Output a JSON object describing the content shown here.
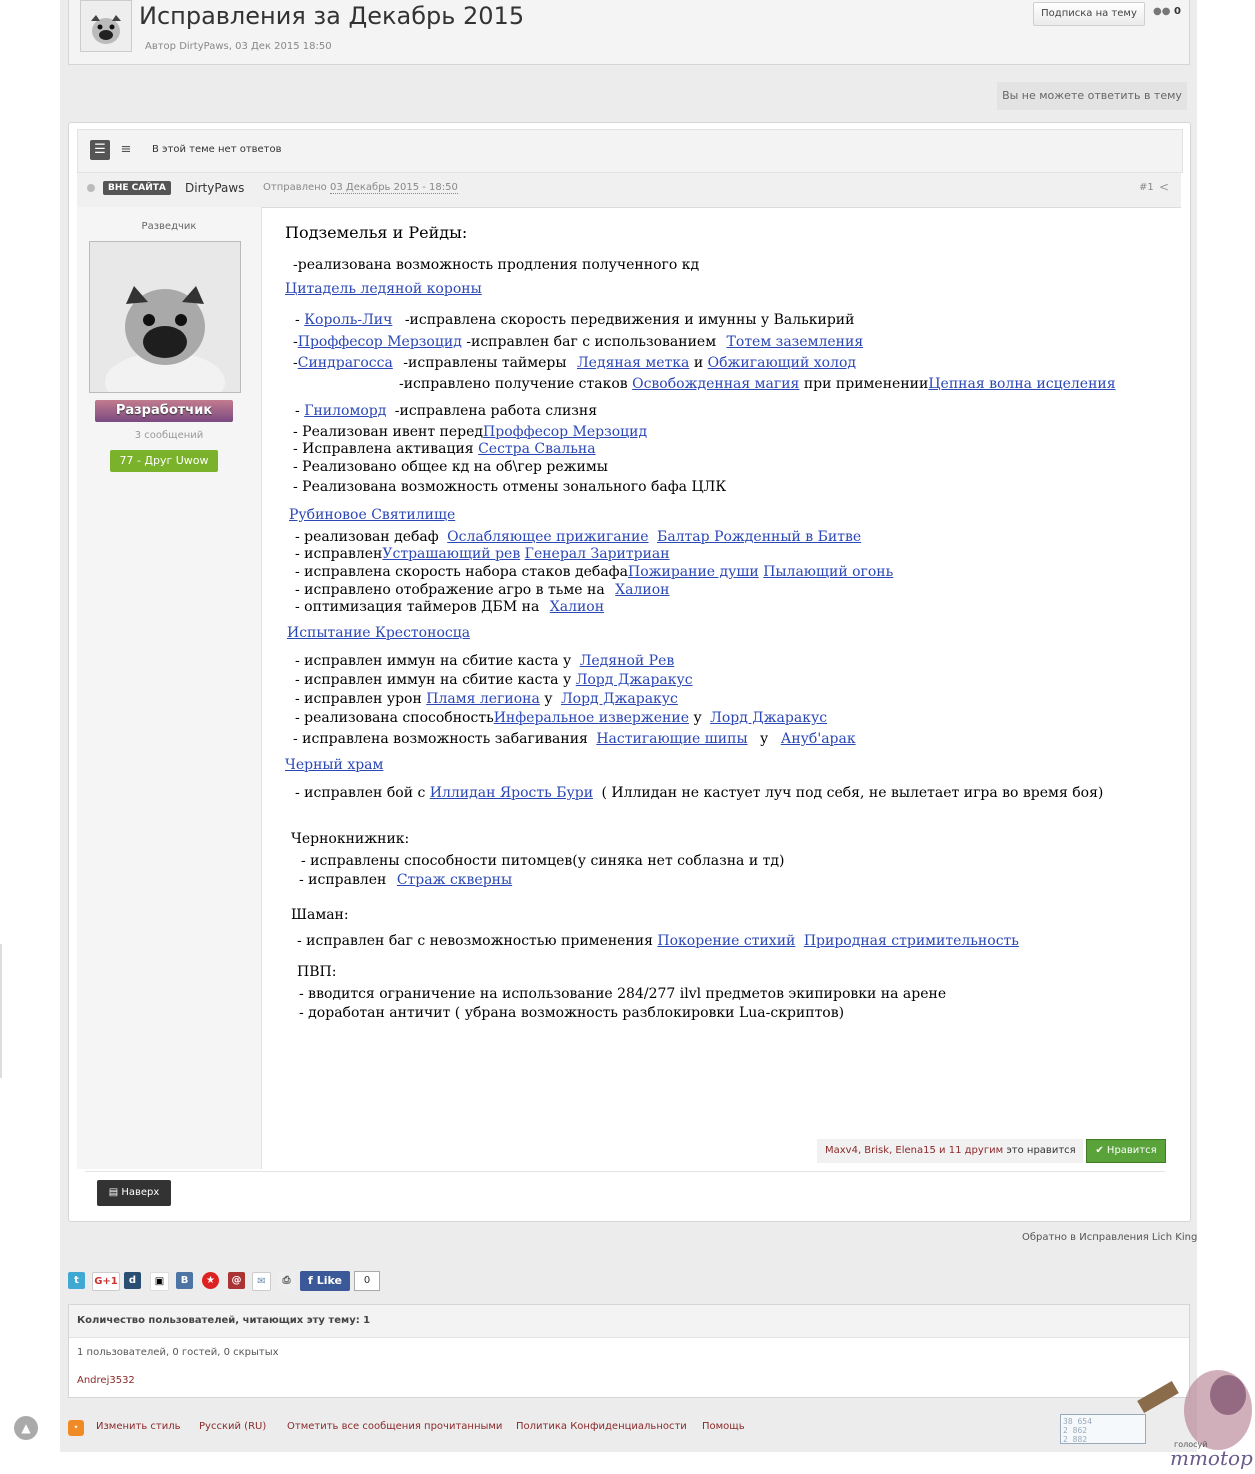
{
  "topic": {
    "title": "Исправления за Декабрь 2015",
    "meta": "Автор DirtyPaws, 03 Дек 2015 18:50",
    "subscribe_label": "Подписка на тему",
    "followers_count": "0",
    "cant_reply": "Вы не можете ответить в тему"
  },
  "toolbar": {
    "no_replies": "В этой теме нет ответов"
  },
  "post": {
    "offline_badge": "ВНЕ САЙТА",
    "author": "DirtyPaws",
    "posted_prefix": "Отправлено",
    "posted_date": "03 Декабрь 2015 - 18:50",
    "number": "#1",
    "author_rank": "Разведчик",
    "group": "Разработчик",
    "post_count": "3 сообщений",
    "reputation": "77 - Друг Uwow"
  },
  "content": {
    "section_dungeons": "Подземелья и Рейды:",
    "l_extend": "-реализована возможность продления полученного кд",
    "icc": "Цитадель ледяной короны",
    "lk_dash": "-",
    "lk": "Король-Лич",
    "lk_text": "-исправлена скорость передвижения и имунны у Валькирий",
    "pp_dash": "-",
    "pp": "Проффесор Мерзоцид",
    "pp_text": "-исправлен баг с использованием",
    "pp_link": "Тотем заземления",
    "sg_dash": "-",
    "sg": "Синдрагосса",
    "sg_text": "-исправлены таймеры",
    "sg_link1": "Ледяная метка",
    "sg_and": "и",
    "sg_link2": "Обжигающий холод",
    "sg_text2": "-исправлено получение стаков",
    "sg_link3": "Освобожденная магия",
    "sg_mid": "при применении",
    "sg_link4": "Цепная волна исцеления",
    "rf_dash": "-",
    "rf": "Гниломорд",
    "rf_text": "-исправлена работа слизня",
    "ev_text": "- Реализован ивент перед",
    "ev_link": "Проффесор Мерзоцид",
    "act_text": "- Исправлена активация",
    "act_link": "Сестра Свальна",
    "l_common": "- Реализовано общее кд на об\\гер режимы",
    "l_buff": "- Реализована возможность отмены зонального бафа ЦЛК",
    "rs": "Рубиновое Святилище",
    "rs1_text": "- реализован дебаф",
    "rs1_link1": "Ослабляющее прижигание",
    "rs1_link2": "Балтар Рожденный в Битве",
    "rs2_text": "- исправлен",
    "rs2_link1": "Устрашающий рев",
    "rs2_link2": "Генерал Заритриан",
    "rs3_text": "- исправлена скорость набора стаков дебафа",
    "rs3_link1": "Пожирание души",
    "rs3_link2": "Пылающий огонь",
    "rs4_text": "- исправлено отображение агро в тьме на",
    "rs4_link": "Халион",
    "rs5_text": "- оптимизация таймеров ДБМ на",
    "rs5_link": "Халион",
    "toc": "Испытание Крестоносца",
    "toc1_text": "- исправлен иммун на сбитие каста у",
    "toc1_link": "Ледяной Рев",
    "toc2_text": "- исправлен иммун на сбитие каста у",
    "toc2_link": "Лорд Джаракус",
    "toc3_text": "- исправлен урон",
    "toc3_link1": "Пламя легиона",
    "toc3_u": "у",
    "toc3_link2": "Лорд Джаракус",
    "toc4_text": "- реализована способность",
    "toc4_link1": "Инферальное извержение",
    "toc4_u": "у",
    "toc4_link2": "Лорд Джаракус",
    "toc5_text": "- исправлена возможность забагивания",
    "toc5_link1": "Настигающие шипы",
    "toc5_u": "у",
    "toc5_link2": "Ануб'арак",
    "bt": "Черный храм",
    "bt1_text": "- исправлен бой с",
    "bt1_link": "Иллидан Ярость Бури",
    "bt1_tail": "( Иллидан не кастует луч под себя, не вылетает игра во время боя)",
    "warlock": "Чернокнижник:",
    "wl1": "- исправлены способности питомцев(у синяка нет соблазна и тд)",
    "wl2_text": "- исправлен",
    "wl2_link": "Страж скверны",
    "shaman": "Шаман:",
    "sh1_text": "- исправлен баг с невозможностью применения",
    "sh1_link1": "Покорение стихий",
    "sh1_link2": "Природная стримительность",
    "pvp": "ПВП:",
    "pvp1": "- вводится ограничение на использование 284/277 ilvl предметов экипировки на арене",
    "pvp2": "- доработан античит ( убрана возможность разблокировки Lua-скриптов)"
  },
  "likes": {
    "names": "Maxv4, Brisk, Elena15",
    "and_label": "и",
    "others_link": "11 другим",
    "suffix": "это нравится",
    "like_button": "Нравится"
  },
  "footer_post": {
    "top_button": "Наверх"
  },
  "back_link": "Обратно в Исправления Lich King",
  "share": {
    "fb_like": "Like",
    "fb_count": "0"
  },
  "readers": {
    "header": "Количество пользователей, читающих эту тему: 1",
    "stats": "1 пользователей, 0 гостей, 0 скрытых",
    "user": "Andrej3532"
  },
  "footer": {
    "links": [
      "Изменить стиль",
      "Русский (RU)",
      "Отметить все сообщения прочитанными",
      "Политика Конфиденциальности",
      "Помощь"
    ],
    "counter_lines": [
      "38 654",
      "2 862",
      "2 882"
    ],
    "mmotop_sub": "голосуй",
    "mmotop": "mmotop"
  },
  "colors": {
    "link": "#2b47b5",
    "like_green": "#5aa33a",
    "group_badge": "#9a5c88",
    "reputation_green": "#7bb22b",
    "footer_link": "#8b2a2a"
  }
}
